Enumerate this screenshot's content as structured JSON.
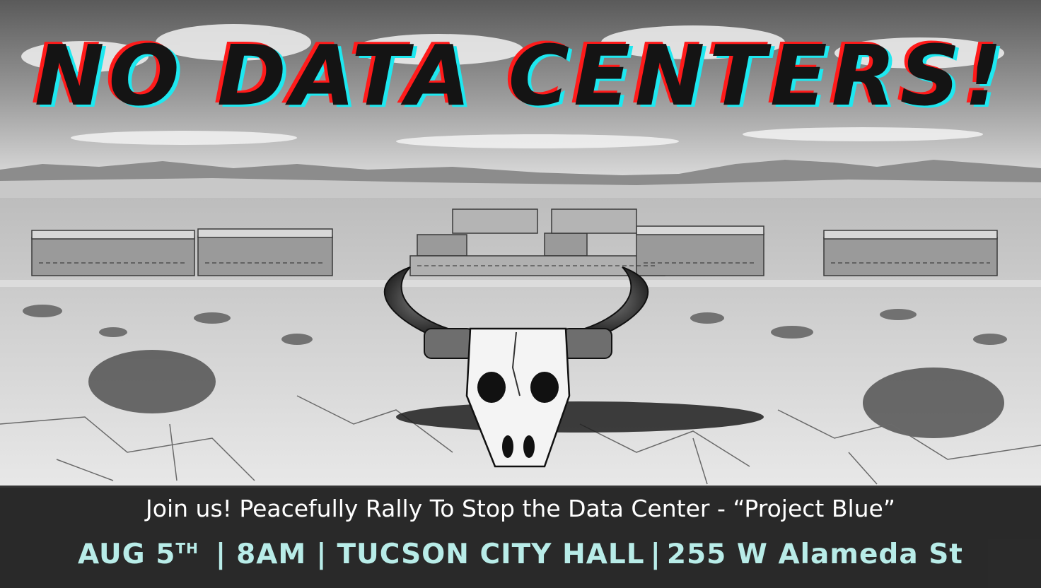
{
  "headline": "NO DATA CENTERS!",
  "tagline": "Join us! Peacefully Rally To Stop the Data Center - “Project Blue”",
  "event": {
    "date": "AUG 5",
    "date_suffix": "TH",
    "separator": "|",
    "time": "8AM",
    "venue": "TUCSON CITY HALL",
    "address": "255 W Alameda St"
  },
  "colors": {
    "headline_fill": "#141414",
    "headline_shadow_red": "#ff1a1a",
    "headline_shadow_cyan": "#1ee8f0",
    "details_text": "#b8ece8",
    "banner_bg": "#242424"
  },
  "illustration": {
    "subject": "bull-skull-icon",
    "background": "desert data center campus"
  }
}
